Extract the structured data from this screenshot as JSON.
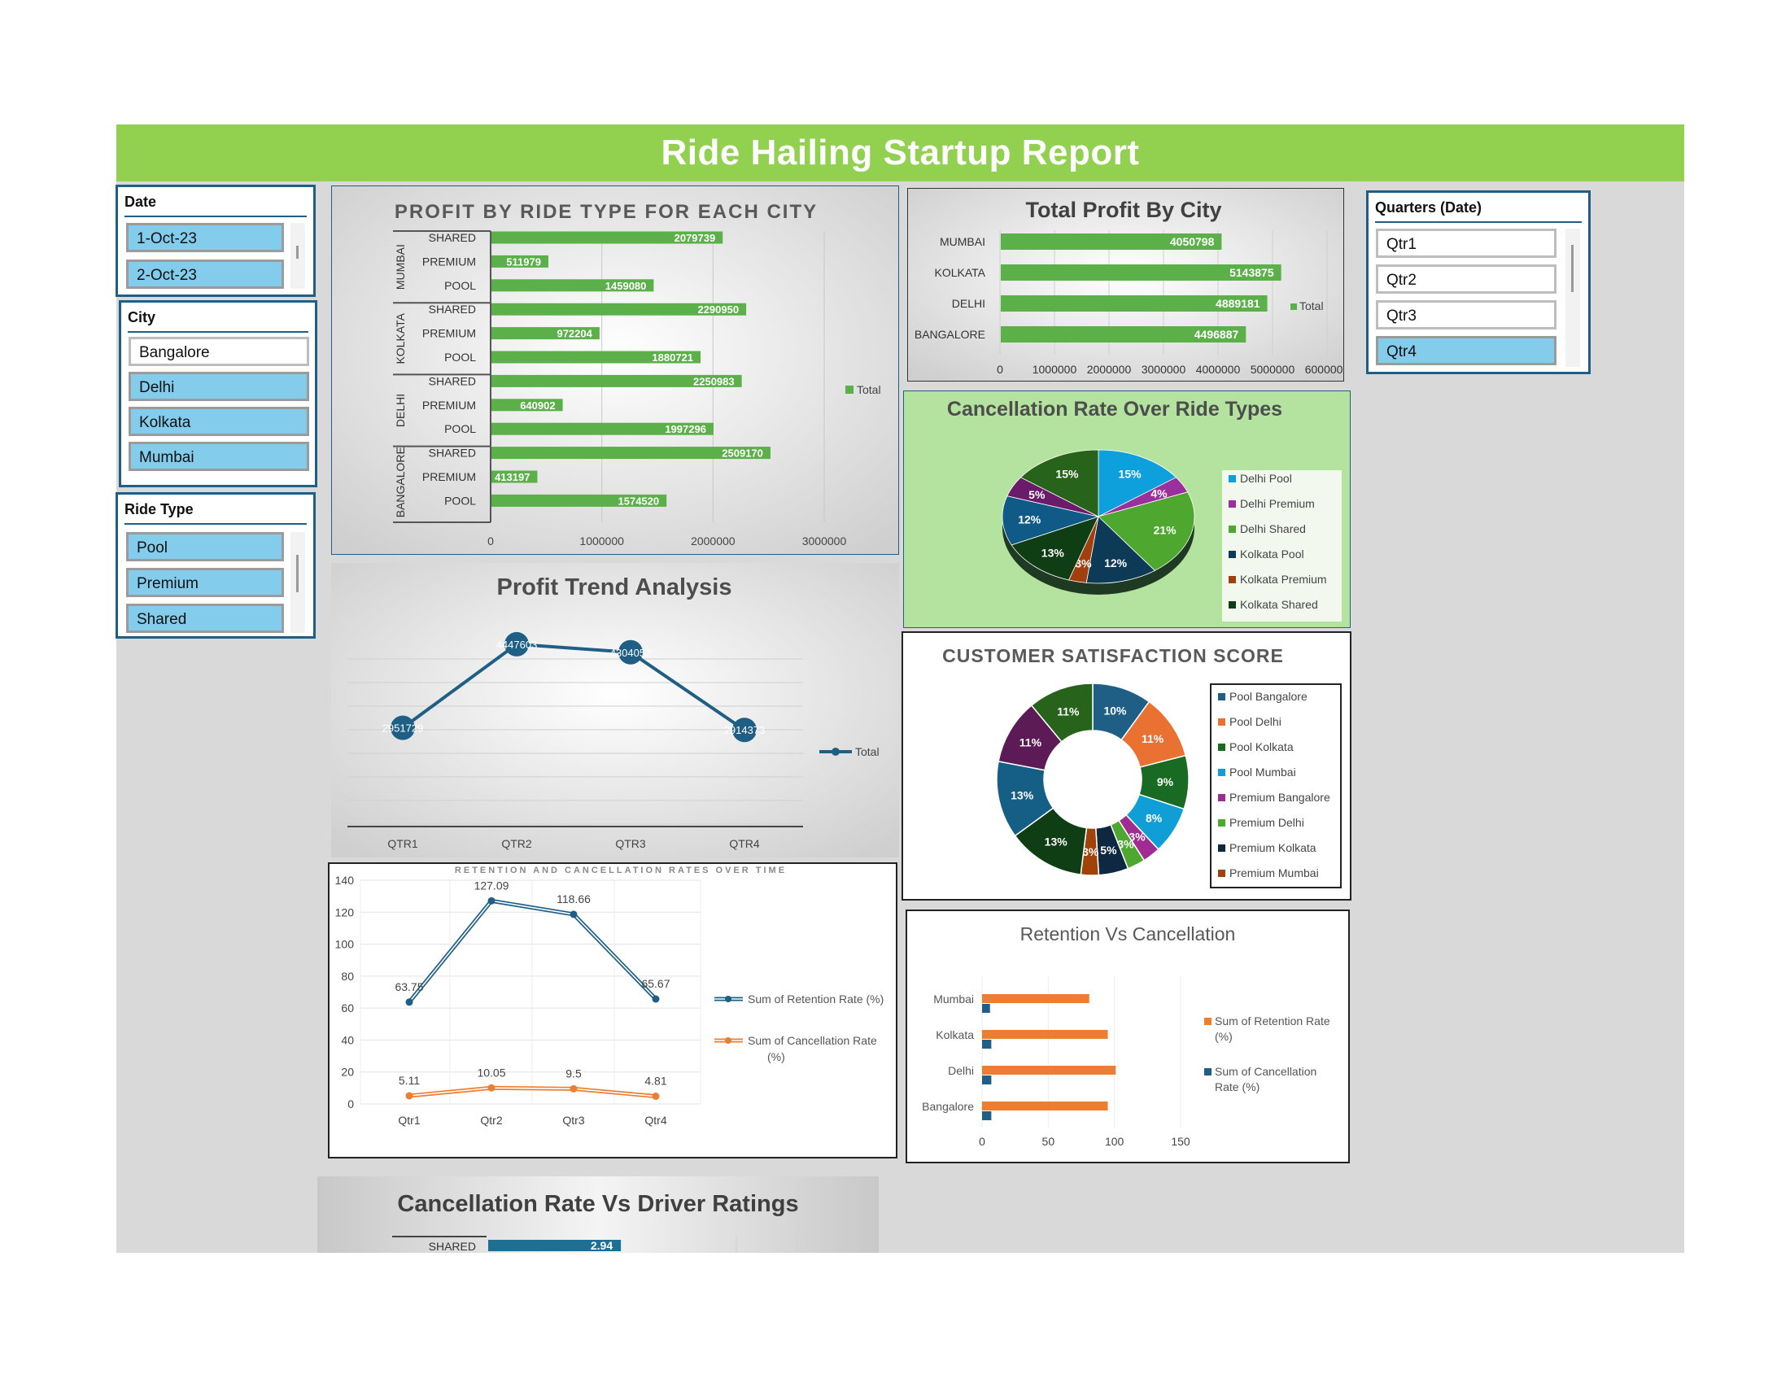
{
  "report_title": "Ride Hailing Startup Report",
  "colors": {
    "header_green": "#92d050",
    "slicer_selected": "#83cceb",
    "bar_green": "#5bb04a",
    "line_blue": "#1f5f86",
    "orange": "#ed7d31"
  },
  "slicers": {
    "date": {
      "title": "Date",
      "items": [
        "1-Oct-23",
        "2-Oct-23"
      ]
    },
    "city": {
      "title": "City",
      "items": [
        "Bangalore",
        "Delhi",
        "Kolkata",
        "Mumbai"
      ]
    },
    "ride_type": {
      "title": "Ride Type",
      "items": [
        "Pool",
        "Premium",
        "Shared"
      ]
    },
    "quarters": {
      "title": "Quarters (Date)",
      "items": [
        "Qtr1",
        "Qtr2",
        "Qtr3",
        "Qtr4"
      ]
    }
  },
  "chart_data": [
    {
      "type": "bar",
      "title": "PROFIT BY RIDE TYPE FOR EACH CITY",
      "groups": [
        "MUMBAI",
        "KOLKATA",
        "DELHI",
        "BANGALORE"
      ],
      "categories": [
        "SHARED",
        "PREMIUM",
        "POOL",
        "SHARED",
        "PREMIUM",
        "POOL",
        "SHARED",
        "PREMIUM",
        "POOL",
        "SHARED",
        "PREMIUM",
        "POOL"
      ],
      "series": [
        {
          "name": "Total",
          "values": [
            2079739,
            511979,
            1459080,
            2290950,
            972204,
            1880721,
            2250983,
            640902,
            1997296,
            2509170,
            413197,
            1574520
          ]
        }
      ],
      "xlim": [
        0,
        3000000
      ],
      "xticks": [
        "0",
        "1000000",
        "2000000",
        "3000000"
      ]
    },
    {
      "type": "bar",
      "title": "Total Profit By City",
      "categories": [
        "MUMBAI",
        "KOLKATA",
        "DELHI",
        "BANGALORE"
      ],
      "series": [
        {
          "name": "Total",
          "values": [
            4050798,
            5143875,
            4889181,
            4496887
          ]
        }
      ],
      "xlim": [
        0,
        6000000
      ],
      "xticks": [
        "0",
        "1000000",
        "2000000",
        "3000000",
        "4000000",
        "5000000",
        "6000000"
      ]
    },
    {
      "type": "pie",
      "title": "Cancellation Rate Over Ride Types",
      "labels": [
        "Delhi Pool",
        "Delhi Premium",
        "Delhi Shared",
        "Kolkata Pool",
        "Kolkata Premium",
        "Kolkata Shared"
      ],
      "slices": [
        {
          "label": "15%",
          "value": 15,
          "color": "#0ea0dc"
        },
        {
          "label": "4%",
          "value": 4,
          "color": "#9b2f9b"
        },
        {
          "label": "21%",
          "value": 21,
          "color": "#4ea72e"
        },
        {
          "label": "12%",
          "value": 12,
          "color": "#0c3a57"
        },
        {
          "label": "3%",
          "value": 3,
          "color": "#a0400e"
        },
        {
          "label": "13%",
          "value": 13,
          "color": "#0f3d14"
        },
        {
          "label": "12%",
          "value": 12,
          "color": "#0f5a86"
        },
        {
          "label": "5%",
          "value": 5,
          "color": "#6a1b6a"
        },
        {
          "label": "15%",
          "value": 15,
          "color": "#27631b"
        }
      ],
      "legend_colors": [
        "#0ea0dc",
        "#9b2f9b",
        "#4ea72e",
        "#0c3a57",
        "#a0400e",
        "#0f3d14"
      ]
    },
    {
      "type": "line",
      "title": "Profit Trend Analysis",
      "categories": [
        "QTR1",
        "QTR2",
        "QTR3",
        "QTR4"
      ],
      "series": [
        {
          "name": "Total",
          "values": [
            2951729,
            4447603,
            4304052,
            2914373
          ]
        }
      ],
      "point_labels": [
        "2951729",
        "4447603",
        "4304052",
        "2914373"
      ],
      "ylim": [
        2000000,
        5000000
      ]
    },
    {
      "type": "line",
      "title": "RETENTION AND CANCELLATION RATES OVER TIME",
      "categories": [
        "Qtr1",
        "Qtr2",
        "Qtr3",
        "Qtr4"
      ],
      "series": [
        {
          "name": "Sum of Retention Rate (%)",
          "values": [
            63.75,
            127.09,
            118.66,
            65.67
          ],
          "labels": [
            "63.75",
            "127.09",
            "118.66",
            "65.67"
          ]
        },
        {
          "name": "Sum of Cancellation Rate (%)",
          "values": [
            5.11,
            10.05,
            9.5,
            4.81
          ],
          "labels": [
            "5.11",
            "10.05",
            "9.5",
            "4.81"
          ]
        }
      ],
      "ylim": [
        0,
        140
      ],
      "yticks": [
        "0",
        "20",
        "40",
        "60",
        "80",
        "100",
        "120",
        "140"
      ]
    },
    {
      "type": "pie",
      "title": "CUSTOMER SATISFACTION SCORE",
      "labels": [
        "Pool Bangalore",
        "Pool Delhi",
        "Pool Kolkata",
        "Pool Mumbai",
        "Premium Bangalore",
        "Premium Delhi",
        "Premium Kolkata",
        "Premium Mumbai"
      ],
      "slices": [
        {
          "label": "10%",
          "value": 10,
          "color": "#1f5f86"
        },
        {
          "label": "11%",
          "value": 11,
          "color": "#e97132"
        },
        {
          "label": "9%",
          "value": 9,
          "color": "#196b24"
        },
        {
          "label": "8%",
          "value": 8,
          "color": "#0f9ed5"
        },
        {
          "label": "3%",
          "value": 3,
          "color": "#a02b93"
        },
        {
          "label": "3%",
          "value": 3,
          "color": "#4ea72e"
        },
        {
          "label": "5%",
          "value": 5,
          "color": "#0e2841"
        },
        {
          "label": "3%",
          "value": 3,
          "color": "#a0430a"
        },
        {
          "label": "13%",
          "value": 13,
          "color": "#0f3d14"
        },
        {
          "label": "13%",
          "value": 13,
          "color": "#155f86"
        },
        {
          "label": "11%",
          "value": 11,
          "color": "#5c1a57"
        },
        {
          "label": "11%",
          "value": 11,
          "color": "#27631b"
        }
      ],
      "legend_colors": [
        "#1f5f86",
        "#e97132",
        "#196b24",
        "#0f9ed5",
        "#a02b93",
        "#4ea72e",
        "#0e2841",
        "#a0430a"
      ]
    },
    {
      "type": "bar",
      "title": "Retention Vs Cancellation",
      "categories": [
        "Mumbai",
        "Kolkata",
        "Delhi",
        "Bangalore"
      ],
      "series": [
        {
          "name": "Sum of Retention Rate (%)",
          "values": [
            81,
            95,
            101,
            95
          ]
        },
        {
          "name": "Sum of Cancellation Rate (%)",
          "values": [
            6,
            7,
            7,
            7
          ]
        }
      ],
      "xlim": [
        0,
        150
      ],
      "xticks": [
        "0",
        "50",
        "100",
        "150"
      ]
    },
    {
      "type": "bar",
      "title": "Cancellation Rate Vs Driver Ratings",
      "categories": [
        "SHARED"
      ],
      "values": [
        2.94
      ],
      "value_labels": [
        "2.94"
      ]
    }
  ]
}
